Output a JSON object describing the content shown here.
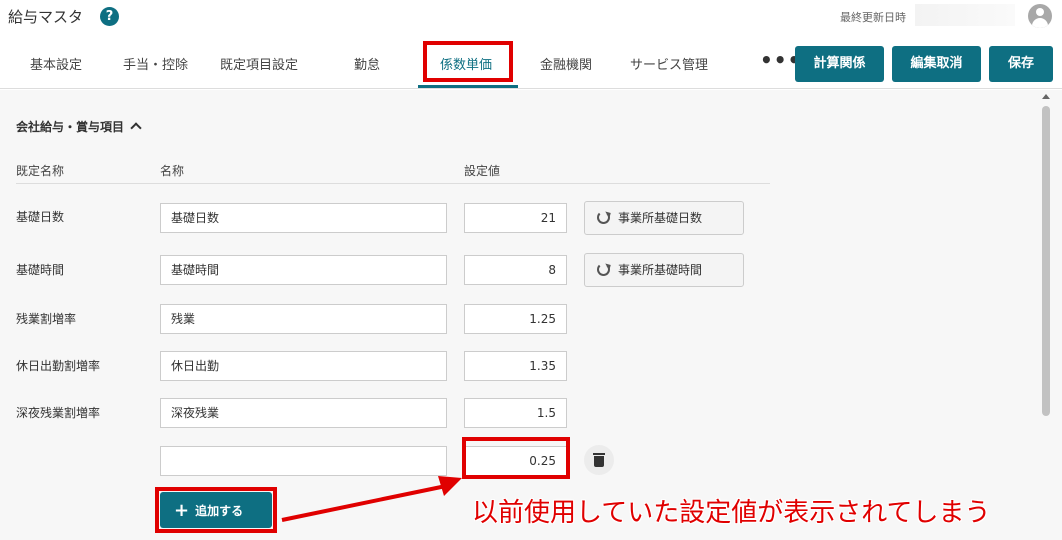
{
  "header": {
    "title": "給与マスタ",
    "help_glyph": "?",
    "last_updated_label": "最終更新日時",
    "help_icon": "help-icon",
    "avatar_icon": "user-avatar-icon"
  },
  "tabs": [
    {
      "label": "基本設定",
      "active": false
    },
    {
      "label": "手当・控除",
      "active": false
    },
    {
      "label": "既定項目設定",
      "active": false
    },
    {
      "label": "勤怠",
      "active": false
    },
    {
      "label": "係数単価",
      "active": true
    },
    {
      "label": "金融機関",
      "active": false
    },
    {
      "label": "サービス管理",
      "active": false
    }
  ],
  "toolbar": {
    "more_label": "•••",
    "calc_label": "計算関係",
    "cancel_label": "編集取消",
    "save_label": "保存"
  },
  "section": {
    "title": "会社給与・賞与項目",
    "columns": {
      "default_name": "既定名称",
      "name": "名称",
      "value": "設定値"
    },
    "rows": [
      {
        "label": "基礎日数",
        "name": "基礎日数",
        "value": "21",
        "action": "事業所基礎日数"
      },
      {
        "label": "基礎時間",
        "name": "基礎時間",
        "value": "8",
        "action": "事業所基礎時間"
      },
      {
        "label": "残業割増率",
        "name": "残業",
        "value": "1.25"
      },
      {
        "label": "休日出勤割増率",
        "name": "休日出勤",
        "value": "1.35"
      },
      {
        "label": "深夜残業割増率",
        "name": "深夜残業",
        "value": "1.5"
      }
    ],
    "new_row": {
      "name": "",
      "value": "0.25"
    },
    "add_label": "追加する"
  },
  "annotation": {
    "text": "以前使用していた設定値が表示されてしまう",
    "color": "#e00000"
  },
  "colors": {
    "accent": "#0e6f82",
    "highlight": "#e00000"
  }
}
